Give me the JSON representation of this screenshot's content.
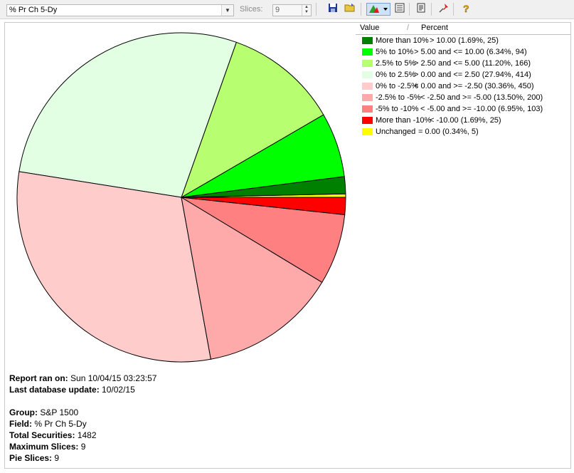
{
  "toolbar": {
    "field_value": "% Pr Ch 5-Dy",
    "slices_label": "Slices:",
    "slices_value": "9",
    "icons": [
      "save-icon",
      "open-folder-icon",
      "pie-chart-icon",
      "list-icon",
      "report-icon",
      "pin-icon",
      "help-icon"
    ]
  },
  "legend": {
    "header_value": "Value",
    "header_percent": "Percent",
    "rows": [
      {
        "label": "More than 10%",
        "range": "> 10.00 (1.69%, 25)",
        "color": "#008000"
      },
      {
        "label": "5% to 10%",
        "range": "> 5.00 and <= 10.00 (6.34%, 94)",
        "color": "#00ff00"
      },
      {
        "label": "2.5% to 5%",
        "range": "> 2.50 and <= 5.00 (11.20%, 166)",
        "color": "#b7ff70"
      },
      {
        "label": "0% to 2.5%",
        "range": "> 0.00 and <= 2.50 (27.94%, 414)",
        "color": "#e3ffe3"
      },
      {
        "label": "0% to -2.5%",
        "range": "< 0.00 and >= -2.50 (30.36%, 450)",
        "color": "#ffcccc"
      },
      {
        "label": "-2.5% to -5%",
        "range": "< -2.50 and >= -5.00 (13.50%, 200)",
        "color": "#ffaaaa"
      },
      {
        "label": "-5% to -10%",
        "range": "< -5.00 and >= -10.00 (6.95%, 103)",
        "color": "#ff8080"
      },
      {
        "label": "More than -10%",
        "range": "< -10.00 (1.69%, 25)",
        "color": "#ff0000"
      },
      {
        "label": "Unchanged",
        "range": "= 0.00 (0.34%, 5)",
        "color": "#ffff00"
      }
    ]
  },
  "report": {
    "ran_label": "Report ran on:",
    "ran_value": "Sun 10/04/15 03:23:57",
    "db_label": "Last database update:",
    "db_value": "10/02/15",
    "group_label": "Group:",
    "group_value": "S&P 1500",
    "field_label": "Field:",
    "field_value": "% Pr Ch 5-Dy",
    "total_label": "Total Securities:",
    "total_value": "1482",
    "max_label": "Maximum Slices:",
    "max_value": "9",
    "pie_label": "Pie Slices:",
    "pie_value": "9"
  },
  "chart_data": {
    "type": "pie",
    "total": 1482,
    "slices": [
      {
        "name": "Unchanged",
        "count": 5,
        "percent": 0.34,
        "color": "#ffff00"
      },
      {
        "name": "More than 10%",
        "count": 25,
        "percent": 1.69,
        "color": "#008000"
      },
      {
        "name": "5% to 10%",
        "count": 94,
        "percent": 6.34,
        "color": "#00ff00"
      },
      {
        "name": "2.5% to 5%",
        "count": 166,
        "percent": 11.2,
        "color": "#b7ff70"
      },
      {
        "name": "0% to 2.5%",
        "count": 414,
        "percent": 27.94,
        "color": "#e3ffe3"
      },
      {
        "name": "0% to -2.5%",
        "count": 450,
        "percent": 30.36,
        "color": "#ffcccc"
      },
      {
        "name": "-2.5% to -5%",
        "count": 200,
        "percent": 13.5,
        "color": "#ffaaaa"
      },
      {
        "name": "-5% to -10%",
        "count": 103,
        "percent": 6.95,
        "color": "#ff8080"
      },
      {
        "name": "More than -10%",
        "count": 25,
        "percent": 1.69,
        "color": "#ff0000"
      }
    ]
  }
}
